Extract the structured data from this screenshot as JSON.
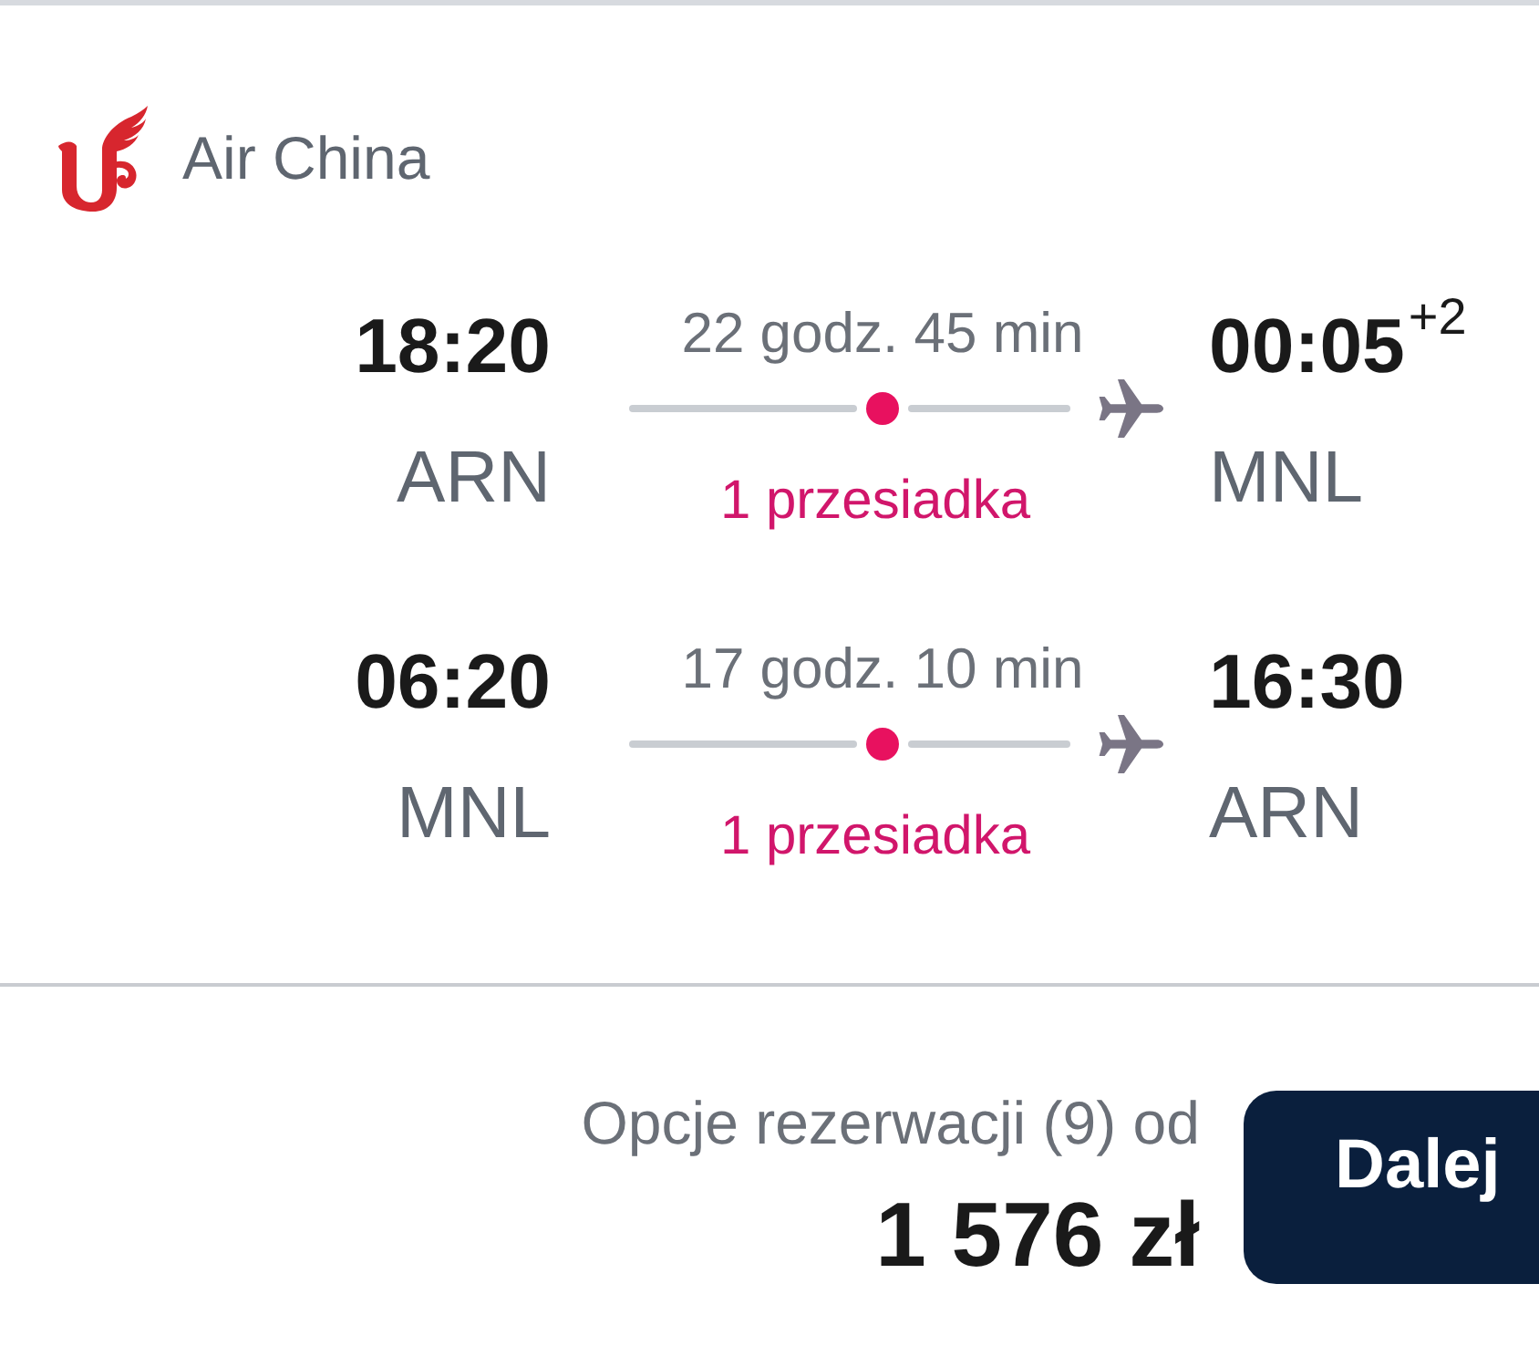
{
  "airline": {
    "name": "Air China"
  },
  "legs": [
    {
      "departure": {
        "time": "18:20",
        "airport": "ARN"
      },
      "duration": "22 godz. 45 min",
      "stops": "1 przesiadka",
      "arrival": {
        "time": "00:05",
        "day_offset": "+2",
        "airport": "MNL"
      }
    },
    {
      "departure": {
        "time": "06:20",
        "airport": "MNL"
      },
      "duration": "17 godz. 10 min",
      "stops": "1 przesiadka",
      "arrival": {
        "time": "16:30",
        "airport": "ARN"
      }
    }
  ],
  "footer": {
    "booking_options": "Opcje rezerwacji (9) od",
    "price": "1 576 zł",
    "button": "Dalej"
  }
}
